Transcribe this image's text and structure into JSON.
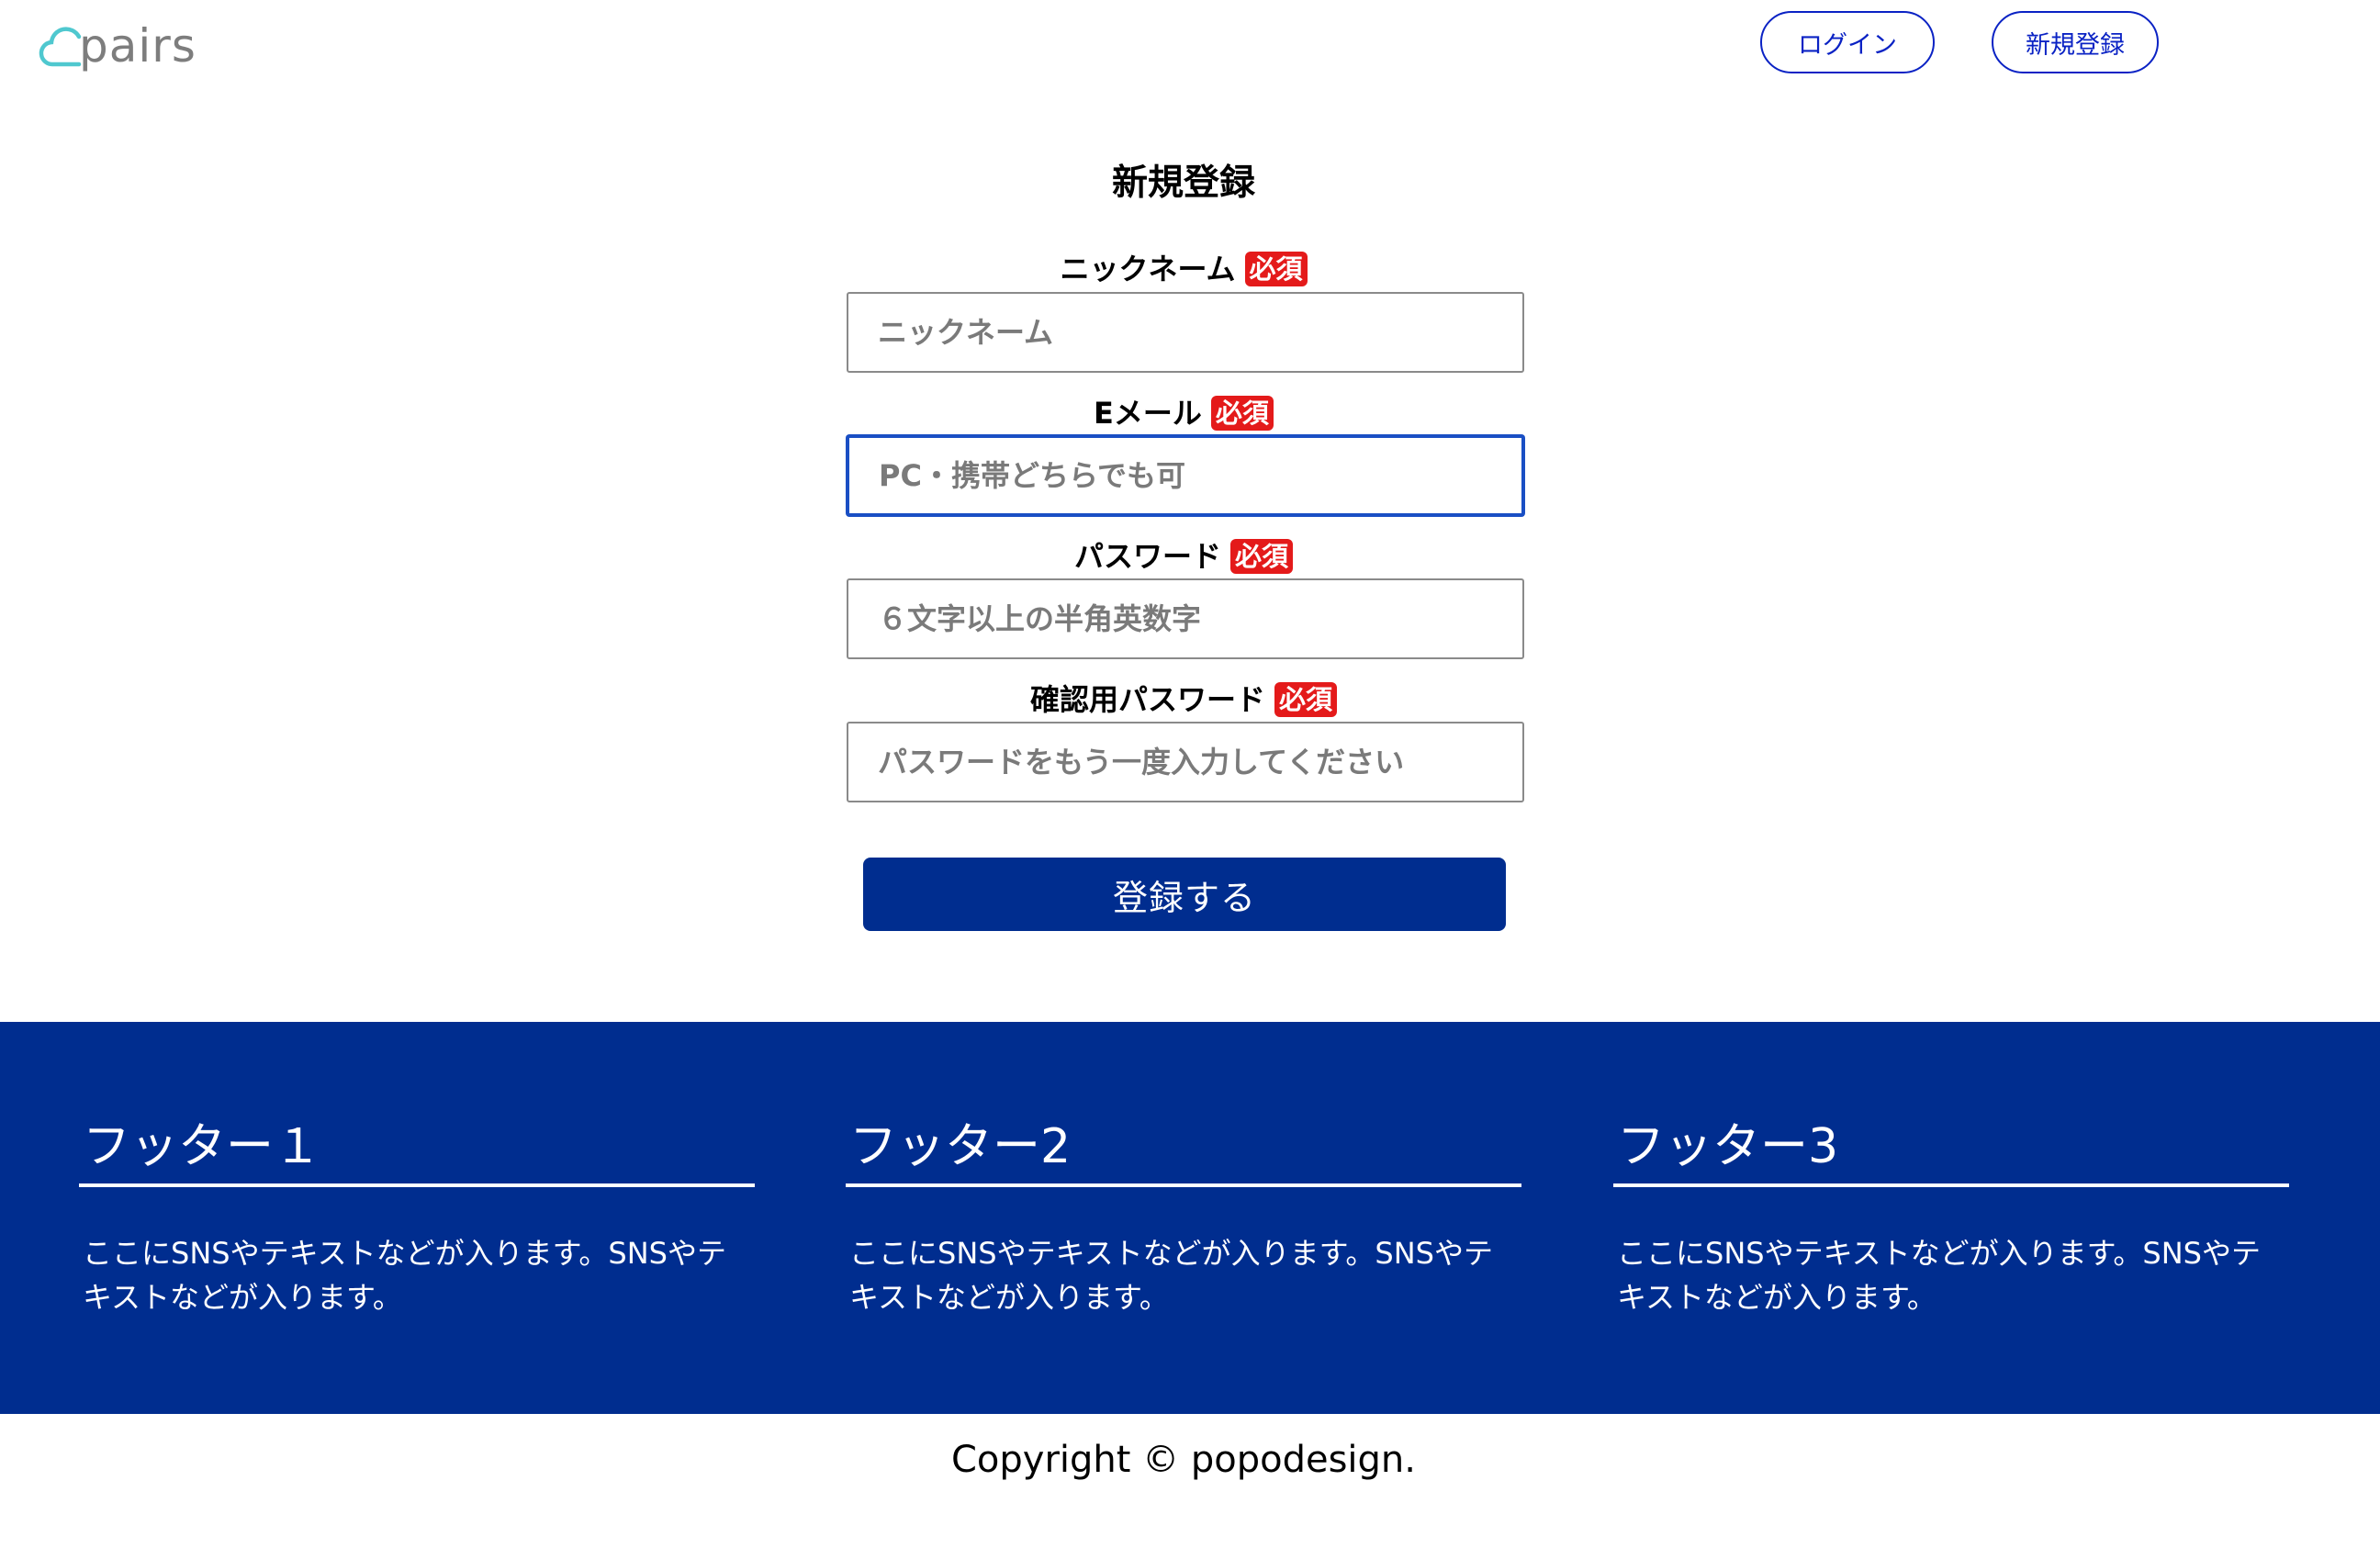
{
  "header": {
    "logo_text": "pairs",
    "login_label": "ログイン",
    "signup_label": "新規登録"
  },
  "form": {
    "title": "新規登録",
    "required_badge": "必須",
    "fields": [
      {
        "label": "ニックネーム",
        "placeholder": "ニックネーム"
      },
      {
        "label": "Eメール",
        "placeholder": "PC・携帯どちらでも可"
      },
      {
        "label": "パスワード",
        "placeholder": "６文字以上の半角英数字"
      },
      {
        "label": "確認用パスワード",
        "placeholder": "パスワードをもう一度入力してください"
      }
    ],
    "submit_label": "登録する"
  },
  "footer": {
    "columns": [
      {
        "heading": "フッター１",
        "text": "ここにSNSやテキストなどが入ります。SNSやテキストなどが入ります。"
      },
      {
        "heading": "フッター2",
        "text": "ここにSNSやテキストなどが入ります。SNSやテキストなどが入ります。"
      },
      {
        "heading": "フッター3",
        "text": "ここにSNSやテキストなどが入ります。SNSやテキストなどが入ります。"
      }
    ]
  },
  "copyright": "Copyright © popodesign.",
  "colors": {
    "primary": "#002d8f",
    "nav_border": "#0a22c4",
    "required": "#e41a1a",
    "logo_accent": "#4fc8cf",
    "logo_text": "#7d7d7d"
  }
}
